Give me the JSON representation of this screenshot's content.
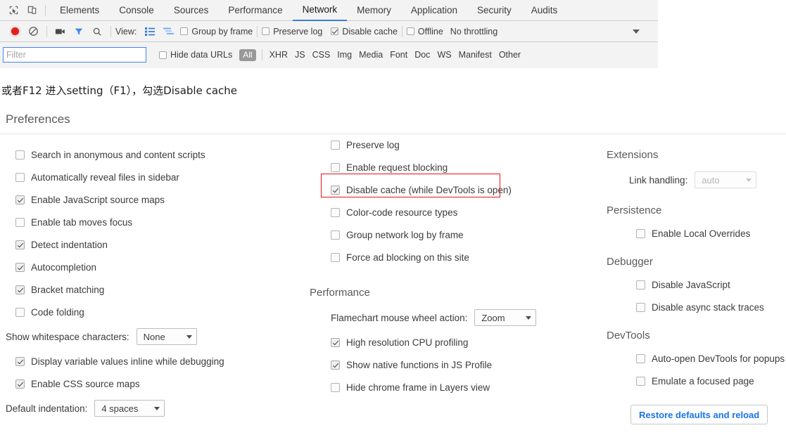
{
  "devtools": {
    "left_icons": [
      {
        "name": "inspect-element-icon",
        "glyph": "inspect"
      },
      {
        "name": "device-toolbar-icon",
        "glyph": "device"
      }
    ],
    "tabs": [
      {
        "label": "Elements",
        "active": false
      },
      {
        "label": "Console",
        "active": false
      },
      {
        "label": "Sources",
        "active": false
      },
      {
        "label": "Performance",
        "active": false
      },
      {
        "label": "Network",
        "active": true
      },
      {
        "label": "Memory",
        "active": false
      },
      {
        "label": "Application",
        "active": false
      },
      {
        "label": "Security",
        "active": false
      },
      {
        "label": "Audits",
        "active": false
      }
    ],
    "controls": {
      "record_icon": "record-dot-icon",
      "clear_icon": "clear-no-entry-icon",
      "capture_screenshots_icon": "camera-icon",
      "filter_icon": "funnel-icon",
      "search_icon": "search-icon",
      "view_label": "View:",
      "view_list_icon": "list-view-icon",
      "view_waterfall_icon": "waterfall-view-icon",
      "group_by_frame": {
        "label": "Group by frame",
        "checked": false
      },
      "preserve_log": {
        "label": "Preserve log",
        "checked": false
      },
      "disable_cache": {
        "label": "Disable cache",
        "checked": true
      },
      "offline": {
        "label": "Offline",
        "checked": false
      },
      "throttling": {
        "label": "No throttling",
        "arrow_icon": "chevron-down-icon"
      }
    },
    "filterbar": {
      "filter_placeholder": "Filter",
      "filter_value": "",
      "hide_data_urls": {
        "label": "Hide data URLs",
        "checked": false
      },
      "types": [
        "All",
        "XHR",
        "JS",
        "CSS",
        "Img",
        "Media",
        "Font",
        "Doc",
        "WS",
        "Manifest",
        "Other"
      ],
      "selected_type": "All"
    }
  },
  "note": "或者F12 进入setting（F1），勾选Disable cache",
  "preferences": {
    "title": "Preferences",
    "left_column": {
      "checkboxes": [
        {
          "label": "Search in anonymous and content scripts",
          "checked": false
        },
        {
          "label": "Automatically reveal files in sidebar",
          "checked": false
        },
        {
          "label": "Enable JavaScript source maps",
          "checked": true
        },
        {
          "label": "Enable tab moves focus",
          "checked": false
        },
        {
          "label": "Detect indentation",
          "checked": true
        },
        {
          "label": "Autocompletion",
          "checked": true
        },
        {
          "label": "Bracket matching",
          "checked": true
        },
        {
          "label": "Code folding",
          "checked": false
        }
      ],
      "whitespace_select": {
        "label": "Show whitespace characters:",
        "value": "None"
      },
      "checkboxes_2": [
        {
          "label": "Display variable values inline while debugging",
          "checked": true
        },
        {
          "label": "Enable CSS source maps",
          "checked": true
        }
      ],
      "indentation_select": {
        "label": "Default indentation:",
        "value": "4 spaces"
      }
    },
    "middle_column": {
      "network_checkboxes": [
        {
          "label": "Preserve log",
          "checked": false
        },
        {
          "label": "Enable request blocking",
          "checked": false
        },
        {
          "label": "Disable cache (while DevTools is open)",
          "checked": true,
          "highlighted": true
        },
        {
          "label": "Color-code resource types",
          "checked": false
        },
        {
          "label": "Group network log by frame",
          "checked": false
        },
        {
          "label": "Force ad blocking on this site",
          "checked": false
        }
      ],
      "performance_title": "Performance",
      "flamechart_select": {
        "label": "Flamechart mouse wheel action:",
        "value": "Zoom"
      },
      "performance_checkboxes": [
        {
          "label": "High resolution CPU profiling",
          "checked": true
        },
        {
          "label": "Show native functions in JS Profile",
          "checked": true
        },
        {
          "label": "Hide chrome frame in Layers view",
          "checked": false
        }
      ]
    },
    "right_column": {
      "extensions_title": "Extensions",
      "link_handling_select": {
        "label": "Link handling:",
        "value": "auto",
        "disabled": true
      },
      "persistence_title": "Persistence",
      "persistence_checkboxes": [
        {
          "label": "Enable Local Overrides",
          "checked": false
        }
      ],
      "debugger_title": "Debugger",
      "debugger_checkboxes": [
        {
          "label": "Disable JavaScript",
          "checked": false
        },
        {
          "label": "Disable async stack traces",
          "checked": false
        }
      ],
      "devtools_title": "DevTools",
      "devtools_checkboxes": [
        {
          "label": "Auto-open DevTools for popups",
          "checked": false
        },
        {
          "label": "Emulate a focused page",
          "checked": false
        }
      ],
      "restore_button": "Restore defaults and reload"
    }
  },
  "colors": {
    "accent_blue": "#3b7fd4",
    "link_blue": "#1a73e8",
    "record_red": "#e02020",
    "highlight_red": "#e81313",
    "panel_bg": "#f3f3f3"
  }
}
